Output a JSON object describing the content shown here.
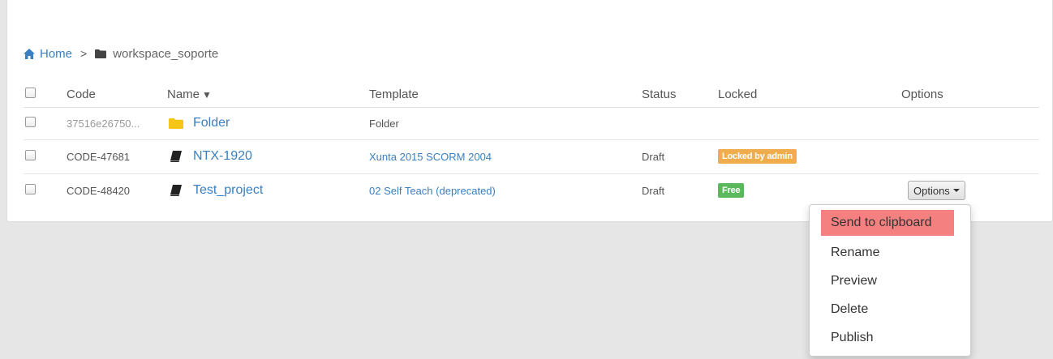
{
  "breadcrumb": {
    "home": "Home",
    "separator": ">",
    "current": "workspace_soporte"
  },
  "table": {
    "headers": {
      "code": "Code",
      "name": "Name",
      "sort_indicator": "▼",
      "template": "Template",
      "status": "Status",
      "locked": "Locked",
      "options": "Options"
    },
    "rows": [
      {
        "code": "37516e26750...",
        "name": "Folder",
        "icon": "folder-icon",
        "template": "Folder",
        "status": "",
        "locked": ""
      },
      {
        "code": "CODE-47681",
        "name": "NTX-1920",
        "icon": "book-icon",
        "template": "Xunta 2015 SCORM 2004",
        "status": "Draft",
        "locked": "Locked by admin"
      },
      {
        "code": "CODE-48420",
        "name": "Test_project",
        "icon": "book-icon",
        "template": "02 Self Teach (deprecated)",
        "status": "Draft",
        "locked": "Free",
        "options_button": "Options"
      }
    ]
  },
  "dropdown": {
    "items": [
      "Send to clipboard",
      "Rename",
      "Preview",
      "Delete",
      "Publish"
    ]
  },
  "colors": {
    "link": "#3a7fc1",
    "badge_locked": "#f0ad4e",
    "badge_free": "#5cb85c",
    "menu_highlight": "#f48080",
    "background": "#e6e6e6"
  }
}
